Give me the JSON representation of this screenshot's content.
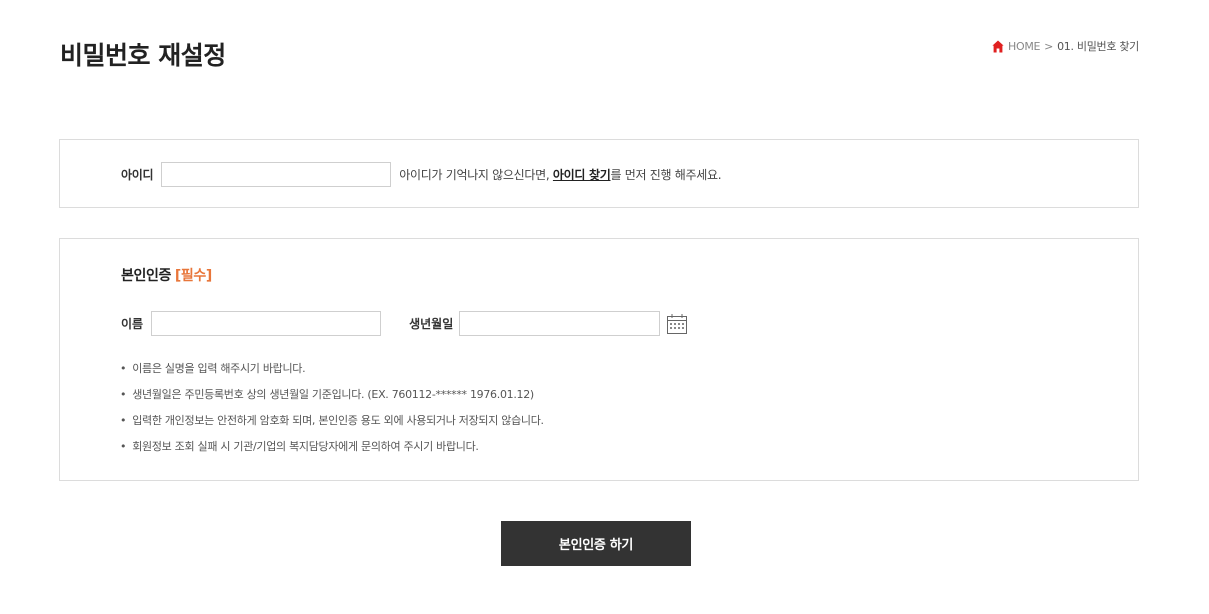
{
  "header": {
    "title": "비밀번호 재설정"
  },
  "breadcrumb": {
    "home": "HOME",
    "separator": ">",
    "current": "01. 비밀번호 찾기"
  },
  "id_section": {
    "label": "아이디",
    "value": "",
    "help_prefix": "아이디가 기억나지 않으신다면, ",
    "help_link": "아이디 찾기",
    "help_suffix": "를 먼저 진행 해주세요."
  },
  "auth_section": {
    "title": "본인인증",
    "required": "[필수]",
    "name_label": "이름",
    "name_value": "",
    "birth_label": "생년월일",
    "birth_value": "",
    "notes": [
      "이름은 실명을 입력 해주시기 바랍니다.",
      "생년월일은 주민등록번호 상의 생년월일 기준입니다. (EX. 760112-****** 1976.01.12)",
      "입력한 개인정보는 안전하게 암호화 되며, 본인인증 용도 외에 사용되거나 저장되지 않습니다.",
      "회원정보 조회 실패 시 기관/기업의 복지담당자에게 문의하여 주시기 바랍니다."
    ]
  },
  "submit": {
    "label": "본인인증 하기"
  },
  "icons": {
    "home": "home-icon",
    "calendar": "calendar-icon"
  },
  "colors": {
    "accent_red": "#e02020",
    "required_orange": "#e8763a",
    "button_bg": "#333333"
  }
}
